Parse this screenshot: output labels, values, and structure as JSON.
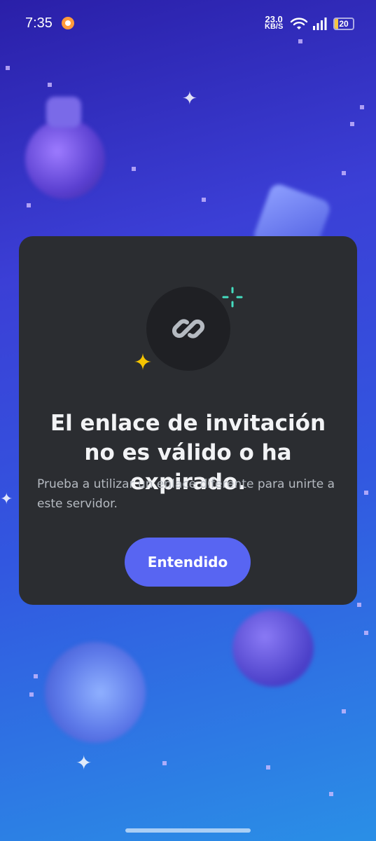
{
  "status_bar": {
    "time": "7:35",
    "net_speed_value": "23.0",
    "net_speed_unit": "KB/S",
    "battery_level": "20",
    "battery_color": "#f5c542"
  },
  "modal": {
    "icon": "link-icon",
    "title": "El enlace de invitación no es válido o ha expirado.",
    "subtitle": "Prueba a utilizar un enlace diferente para unirte a este servidor.",
    "button_label": "Entendido",
    "accent_color": "#5865f2",
    "background_color": "#2b2d31"
  }
}
